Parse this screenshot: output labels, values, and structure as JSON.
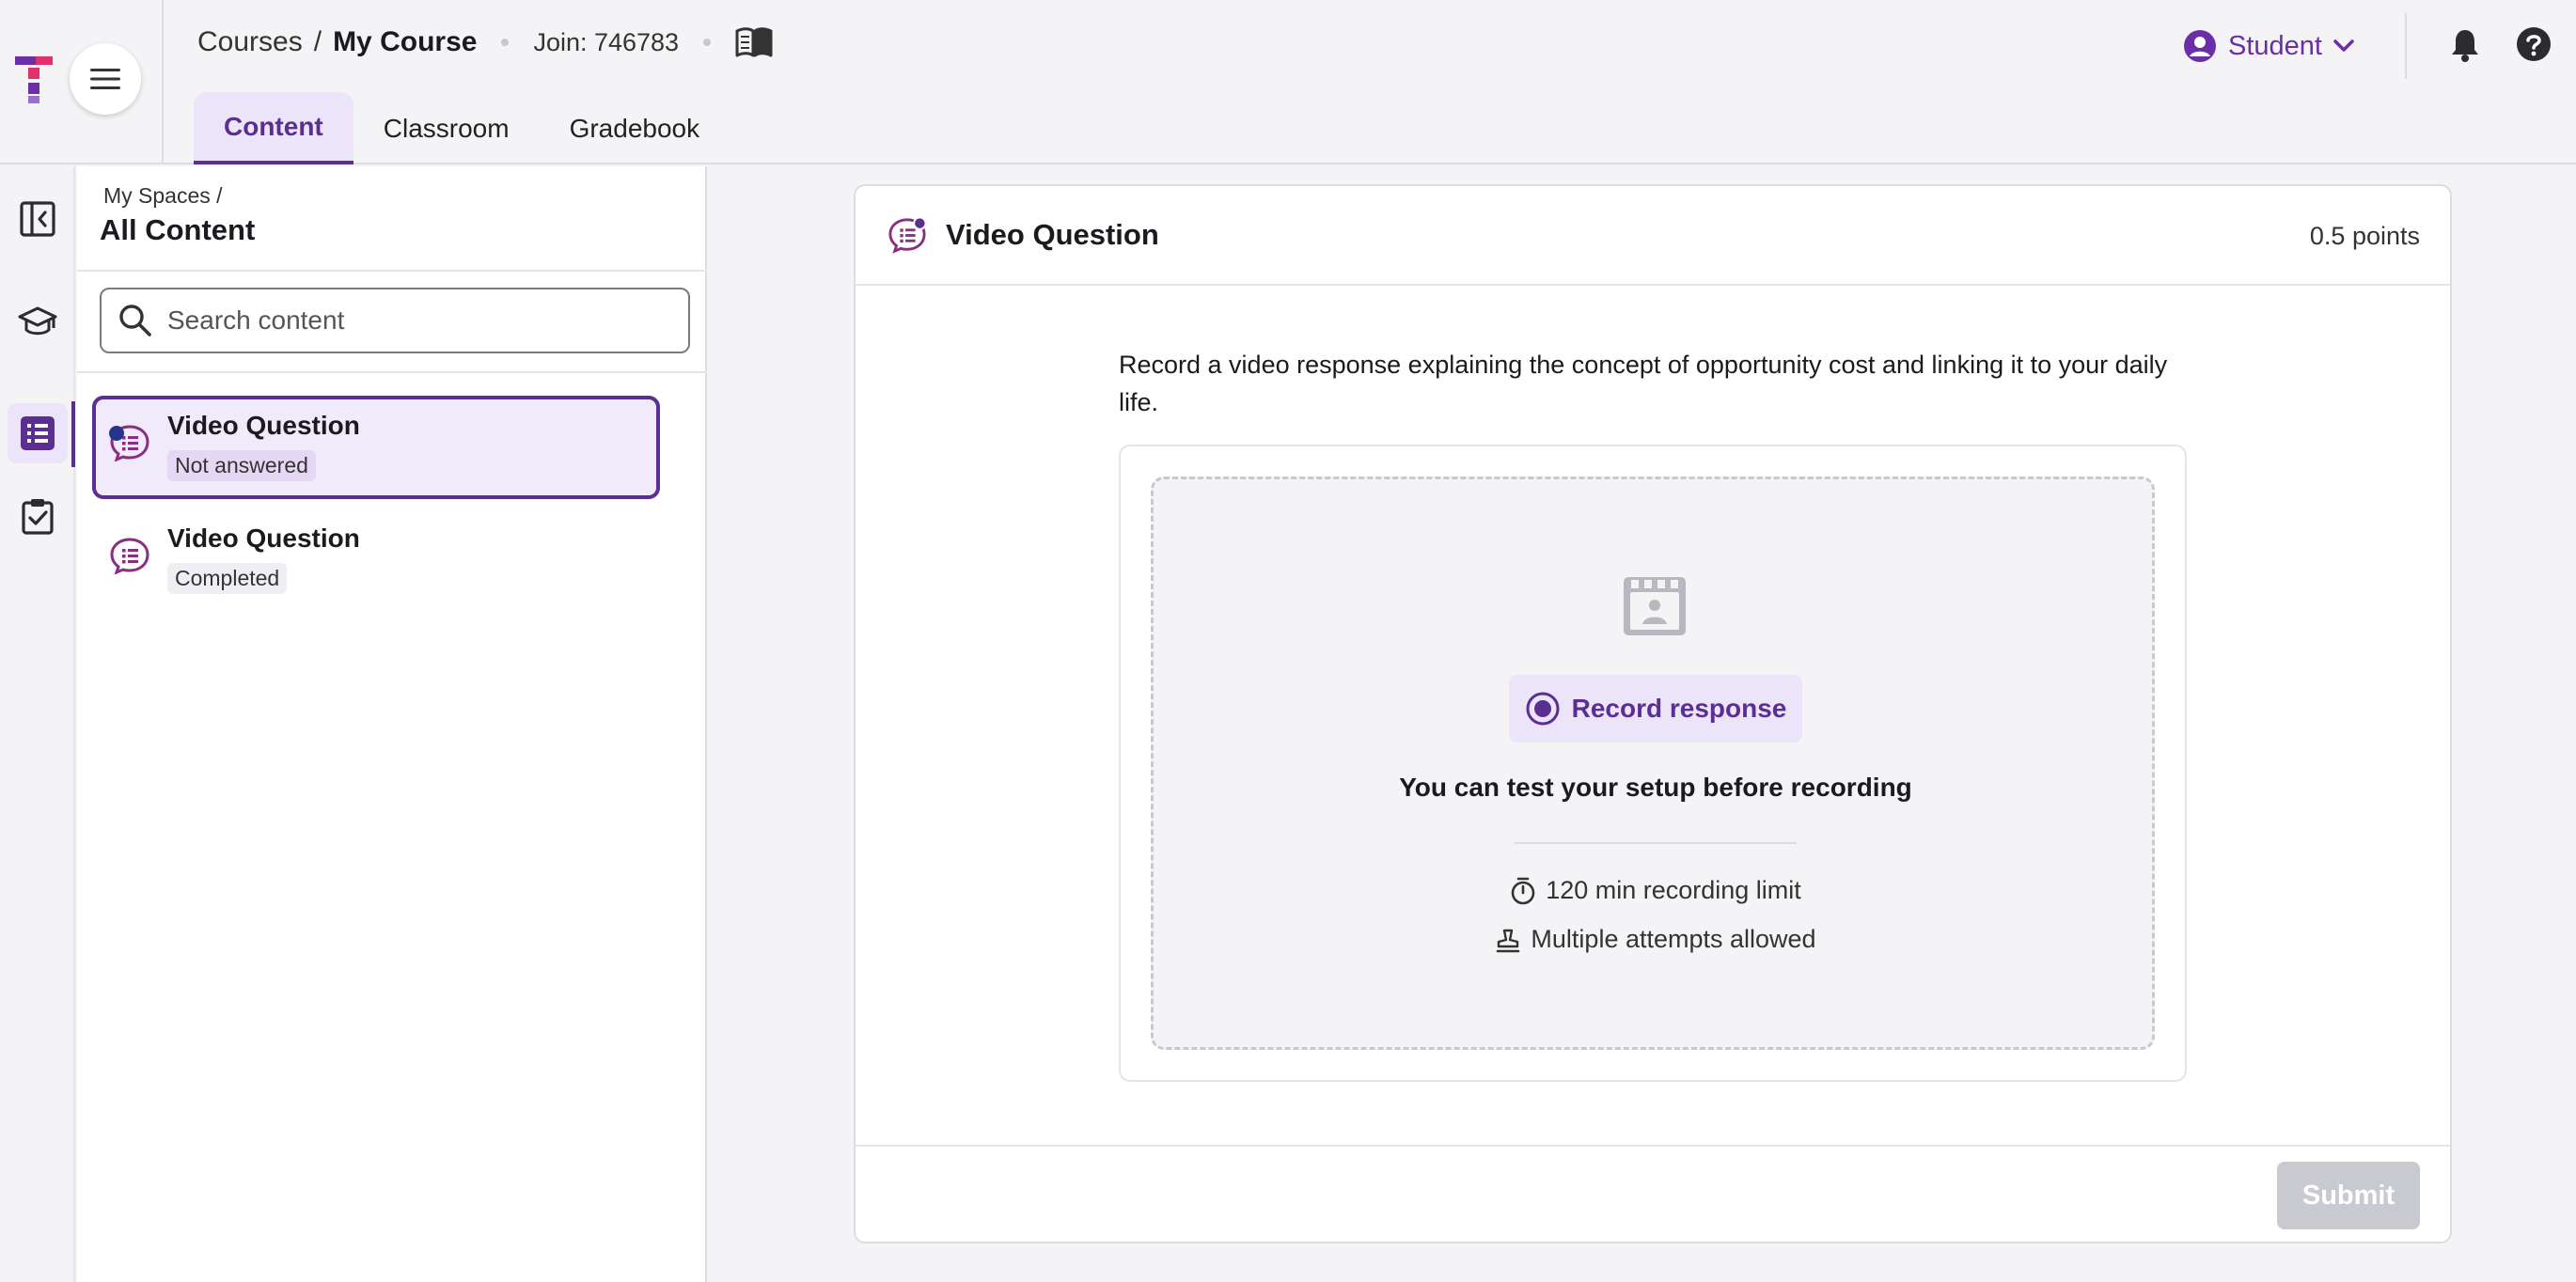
{
  "header": {
    "breadcrumb": {
      "parent": "Courses",
      "separator": "/",
      "current": "My Course"
    },
    "join_label": "Join: 746783",
    "tabs": [
      {
        "label": "Content",
        "active": true
      },
      {
        "label": "Classroom",
        "active": false
      },
      {
        "label": "Gradebook",
        "active": false
      }
    ],
    "role_label": "Student"
  },
  "sidebar": {
    "breadcrumb": "My Spaces /",
    "title": "All Content",
    "search_placeholder": "Search content",
    "items": [
      {
        "title": "Video Question",
        "status": "Not answered",
        "selected": true
      },
      {
        "title": "Video Question",
        "status": "Completed",
        "selected": false
      }
    ]
  },
  "question": {
    "title": "Video Question",
    "points": "0.5 points",
    "prompt": "Record a video response explaining the concept of opportunity cost and linking it to your daily life.",
    "record_button": "Record response",
    "setup_text": "You can test your setup before recording",
    "limit_text": "120 min recording limit",
    "attempts_text": "Multiple attempts allowed",
    "submit_label": "Submit"
  },
  "colors": {
    "accent": "#5b2e91",
    "accent_light": "#ece4f8",
    "brand_logo_top": "#e0316b",
    "brand_logo_bottom": "#6a2fa6",
    "disabled": "#c9c9d0"
  }
}
